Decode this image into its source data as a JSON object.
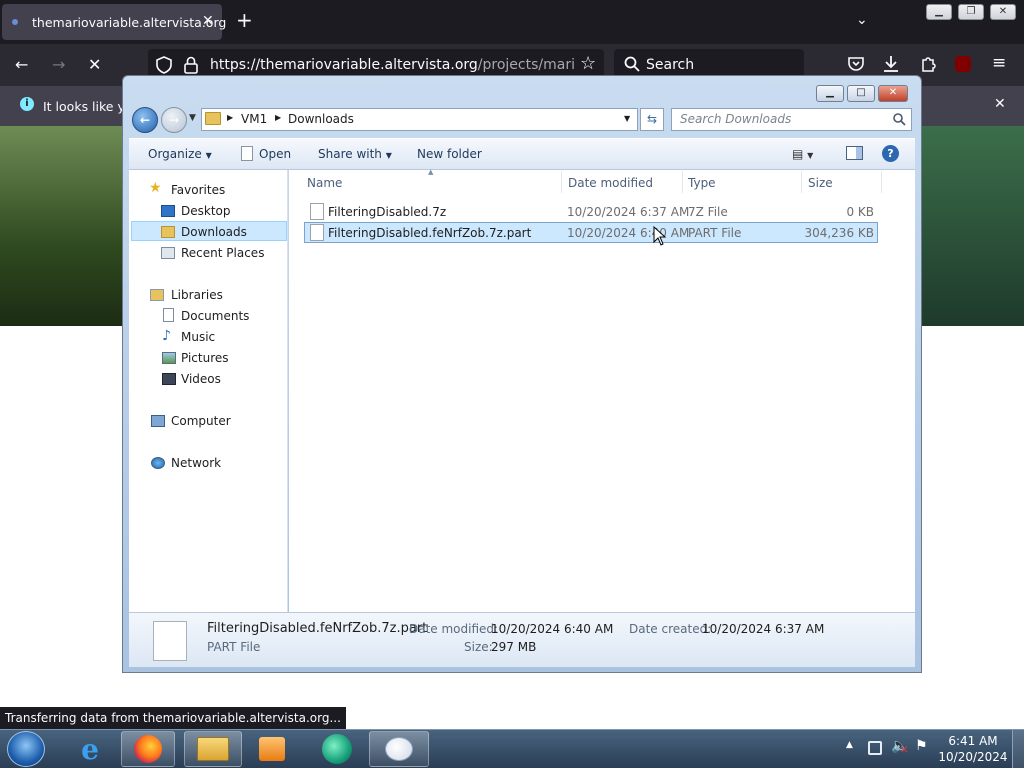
{
  "browser": {
    "tab_title": "themariovariable.altervista.org",
    "new_tab": "+",
    "url_host": "https://themariovariable.altervista.org",
    "url_path": "/projects/mario-forev",
    "search_placeholder": "Search",
    "notice_text": "It looks like you",
    "status_text": "Transferring data from themariovariable.altervista.org..."
  },
  "explorer": {
    "breadcrumb": [
      "VM1",
      "Downloads"
    ],
    "search_placeholder": "Search Downloads",
    "toolbar": {
      "organize": "Organize",
      "open": "Open",
      "share_with": "Share with",
      "new_folder": "New folder"
    },
    "nav": {
      "favorites": "Favorites",
      "desktop": "Desktop",
      "downloads": "Downloads",
      "recent_places": "Recent Places",
      "libraries": "Libraries",
      "documents": "Documents",
      "music": "Music",
      "pictures": "Pictures",
      "videos": "Videos",
      "computer": "Computer",
      "network": "Network"
    },
    "columns": {
      "name": "Name",
      "date_modified": "Date modified",
      "type": "Type",
      "size": "Size"
    },
    "files": [
      {
        "name": "FilteringDisabled.7z",
        "date": "10/20/2024 6:37 AM",
        "type": "7Z File",
        "size": "0 KB"
      },
      {
        "name": "FilteringDisabled.feNrfZob.7z.part",
        "date": "10/20/2024 6:40 AM",
        "type": "PART File",
        "size": "304,236 KB"
      }
    ],
    "details": {
      "file_name": "FilteringDisabled.feNrfZob.7z.part",
      "file_type": "PART File",
      "date_modified_label": "Date modified:",
      "date_modified": "10/20/2024 6:40 AM",
      "size_label": "Size:",
      "size": "297 MB",
      "date_created_label": "Date created:",
      "date_created": "10/20/2024 6:37 AM"
    }
  },
  "taskbar": {
    "time": "6:41 AM",
    "date": "10/20/2024"
  }
}
